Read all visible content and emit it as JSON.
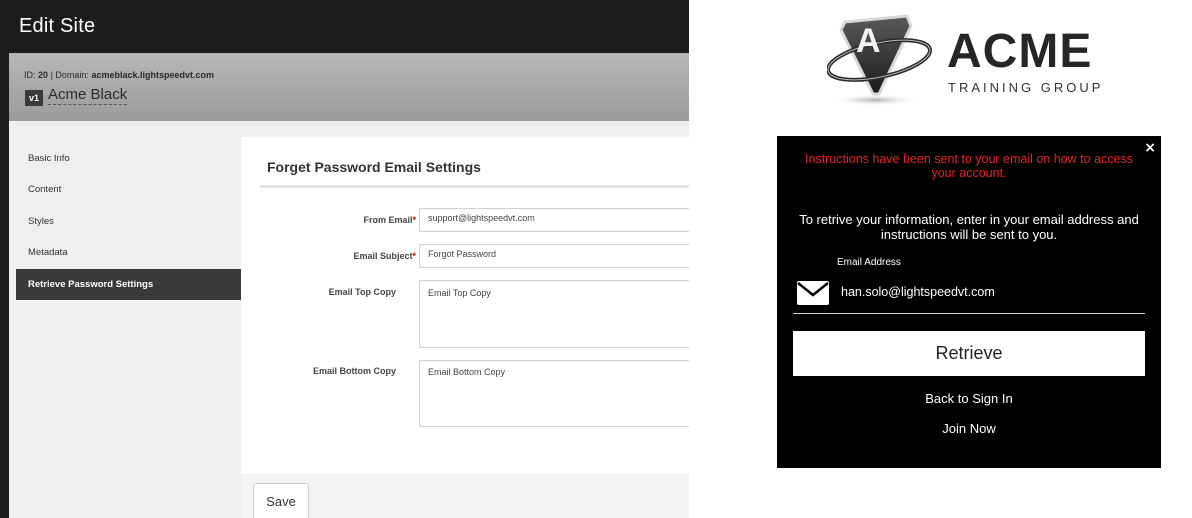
{
  "admin": {
    "title": "Edit Site",
    "site_meta": {
      "id_label": "ID:",
      "id_value": "20",
      "separator": "|",
      "domain_label": "Domain:",
      "domain_value": "acmeblack.lightspeedvt.com"
    },
    "version_badge": "v1",
    "site_name": "Acme Black",
    "nav": [
      {
        "label": "Basic Info",
        "active": false
      },
      {
        "label": "Content",
        "active": false
      },
      {
        "label": "Styles",
        "active": false
      },
      {
        "label": "Metadata",
        "active": false
      },
      {
        "label": "Retrieve Password Settings",
        "active": true
      }
    ],
    "form": {
      "title": "Forget Password Email Settings",
      "from_email": {
        "label": "From Email",
        "required": "*",
        "value": "support@lightspeedvt.com"
      },
      "email_subject": {
        "label": "Email Subject",
        "required": "*",
        "value": "Forgot Password"
      },
      "email_top_copy": {
        "label": "Email Top Copy",
        "placeholder": "Email Top Copy"
      },
      "email_bottom_copy": {
        "label": "Email Bottom Copy",
        "placeholder": "Email Bottom Copy"
      },
      "save_label": "Save"
    }
  },
  "preview": {
    "logo": {
      "letter": "A",
      "name": "ACME",
      "tagline": "TRAINING GROUP"
    },
    "modal": {
      "close_glyph": "×",
      "alert": "Instructions have been sent to your email on how to access your account.",
      "instructions": "To retrive your information, enter in your email address and instructions will be sent to you.",
      "email_label": "Email Address",
      "email_value": "han.solo@lightspeedvt.com",
      "retrieve_label": "Retrieve",
      "back_link": "Back to Sign In",
      "join_link": "Join Now"
    }
  },
  "colors": {
    "alert_red": "#e8231f",
    "admin_dark": "#1c1c1c",
    "modal_bg": "#000000"
  },
  "icons": {
    "envelope": "envelope-icon",
    "close": "close-icon"
  }
}
